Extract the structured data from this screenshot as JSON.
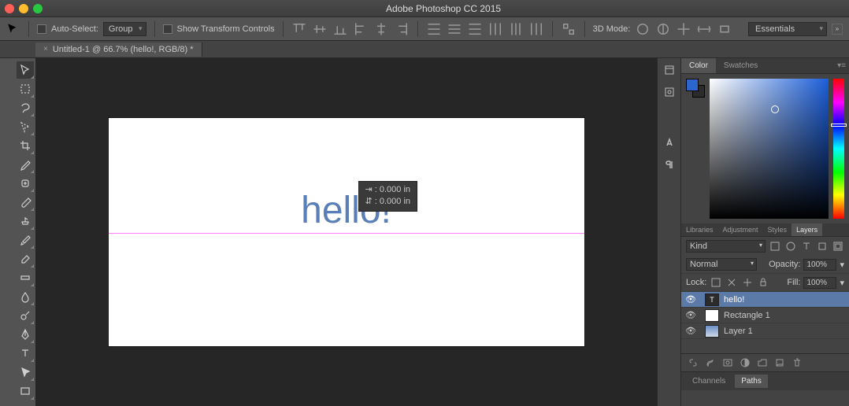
{
  "titlebar": {
    "title": "Adobe Photoshop CC 2015"
  },
  "optionsbar": {
    "auto_select_label": "Auto-Select:",
    "auto_select_value": "Group",
    "show_transform_label": "Show Transform Controls",
    "mode3d_label": "3D Mode:",
    "workspace": "Essentials"
  },
  "doctab": {
    "name": "Untitled-1 @ 66.7% (hello!, RGB/8) *"
  },
  "canvas": {
    "text": "hello!",
    "measure_h": "⇥ : 0.000 in",
    "measure_v": "⇵ : 0.000 in"
  },
  "panels": {
    "color_tab": "Color",
    "swatches_tab": "Swatches",
    "libraries_tab": "Libraries",
    "adjustment_tab": "Adjustment",
    "styles_tab": "Styles",
    "layers_tab": "Layers",
    "filter_kind": "Kind",
    "blend_mode": "Normal",
    "opacity_label": "Opacity:",
    "opacity_value": "100%",
    "lock_label": "Lock:",
    "fill_label": "Fill:",
    "fill_value": "100%",
    "layers": [
      {
        "name": "hello!",
        "type": "T"
      },
      {
        "name": "Rectangle 1",
        "type": "rect"
      },
      {
        "name": "Layer 1",
        "type": "img"
      }
    ],
    "channels_tab": "Channels",
    "paths_tab": "Paths"
  }
}
